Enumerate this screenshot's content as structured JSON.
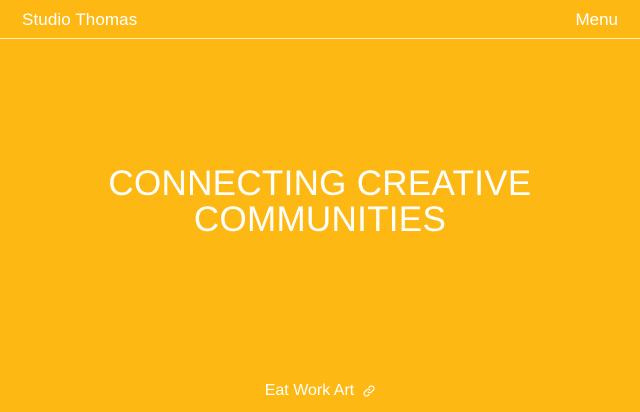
{
  "theme": {
    "background": "#FDB813",
    "foreground": "#FFFFFF"
  },
  "header": {
    "brand": "Studio Thomas",
    "menu_label": "Menu"
  },
  "hero": {
    "title_line_1": "CONNECTING CREATIVE",
    "title_line_2": "COMMUNITIES"
  },
  "footer": {
    "link_label": "Eat Work Art",
    "link_icon": "link-icon"
  }
}
